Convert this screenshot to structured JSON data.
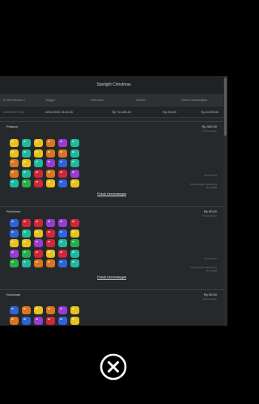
{
  "modal": {
    "title": "Starlight Christmas",
    "table": {
      "headers": [
        "ID Sesi Bermain #",
        "Tanggal",
        "Saldo Baru",
        "Taruhan",
        "Jumlah Dimenangkan"
      ],
      "row": [
        "6335508771645",
        "22/11/2023, 05.34.35",
        "Rp 711.300,00",
        "Rp 200,00",
        "Rp 63.000,00"
      ]
    },
    "rounds": [
      {
        "name": "Putaran",
        "amount": "Rp 900,00",
        "amount_label": "Kemenangan",
        "info": [
          "Tempat 185",
          "Kemenangan Berikutnya",
          "Rp 18000"
        ],
        "link": "Pokok Kemenangan",
        "grid": [
          [
            "yellow",
            "teal",
            "yellow",
            "orange",
            "purple",
            "teal"
          ],
          [
            "yellow",
            "teal",
            "yellow",
            "orange",
            "orange",
            "teal"
          ],
          [
            "orange",
            "yellow",
            "teal",
            "purple",
            "blue",
            "teal"
          ],
          [
            "orange",
            "teal",
            "red",
            "orange",
            "red",
            "purple"
          ],
          [
            "teal",
            "green",
            "red",
            "yellow",
            "blue",
            "yellow"
          ]
        ]
      },
      {
        "name": "Runtuhan",
        "amount": "Rp 80,00",
        "amount_label": "Kemenangan",
        "info": [
          "Tempat 185",
          "Kemenangan Berikutnya",
          "Rp 18000"
        ],
        "link": "Pokok Kemenangan",
        "grid": [
          [
            "blue",
            "red",
            "red",
            "purple",
            "purple",
            "red"
          ],
          [
            "blue",
            "teal",
            "yellow",
            "red",
            "blue",
            "yellow"
          ],
          [
            "yellow",
            "yellow",
            "purple",
            "red",
            "teal",
            "green"
          ],
          [
            "purple",
            "green",
            "red",
            "yellow",
            "red",
            "teal"
          ],
          [
            "green",
            "teal",
            "orange",
            "orange",
            "blue",
            "teal"
          ]
        ]
      },
      {
        "name": "Runtuhan",
        "amount": "Rp 50,00",
        "amount_label": "Kemenangan",
        "grid": [
          [
            "blue",
            "orange",
            "yellow",
            "orange",
            "purple",
            "yellow"
          ],
          [
            "orange",
            "blue",
            "purple",
            "red",
            "blue",
            "yellow"
          ]
        ]
      }
    ]
  },
  "close_icon": "close-icon",
  "colors": {
    "yellow": "#e8c21e",
    "teal": "#1fb99e",
    "orange": "#d9761f",
    "purple": "#9a3bd3",
    "blue": "#2f63d8",
    "red": "#d2263a",
    "green": "#25b04a"
  }
}
